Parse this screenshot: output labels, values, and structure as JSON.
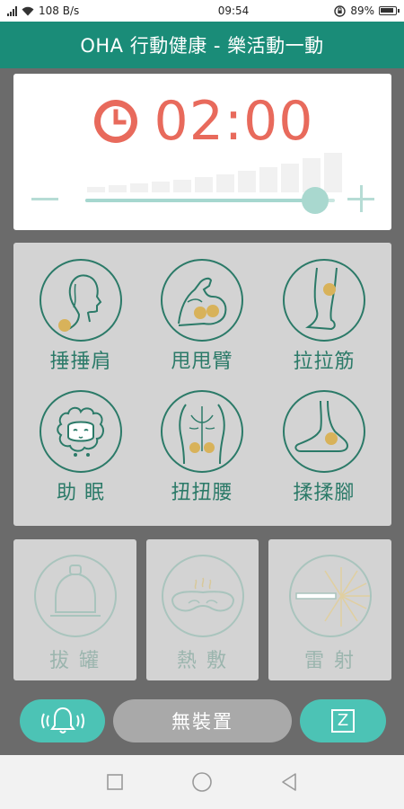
{
  "status_bar": {
    "speed": "108 B/s",
    "time": "09:54",
    "battery": "89%"
  },
  "header": {
    "title": "OHA 行動健康 - 樂活動一動"
  },
  "timer": {
    "value": "02:00",
    "level": 0.92,
    "accent_color": "#e86a5c"
  },
  "massage_modes": [
    {
      "label": "捶捶肩",
      "icon": "shoulder-icon"
    },
    {
      "label": "甩甩臂",
      "icon": "arm-icon"
    },
    {
      "label": "拉拉筋",
      "icon": "leg-icon"
    },
    {
      "label": "助 眠",
      "icon": "sheep-icon"
    },
    {
      "label": "扭扭腰",
      "icon": "back-icon"
    },
    {
      "label": "揉揉腳",
      "icon": "foot-icon"
    }
  ],
  "devices": [
    {
      "label": "拔 罐",
      "icon": "cupping-icon"
    },
    {
      "label": "熱 敷",
      "icon": "eye-mask-icon"
    },
    {
      "label": "雷 射",
      "icon": "laser-icon"
    }
  ],
  "bottom": {
    "device_status": "無裝置",
    "sleep_label": "Z"
  },
  "colors": {
    "header": "#1a8c78",
    "accent": "#4cc3b5",
    "icon_stroke": "#2b7a68",
    "dot": "#d8b25a"
  }
}
